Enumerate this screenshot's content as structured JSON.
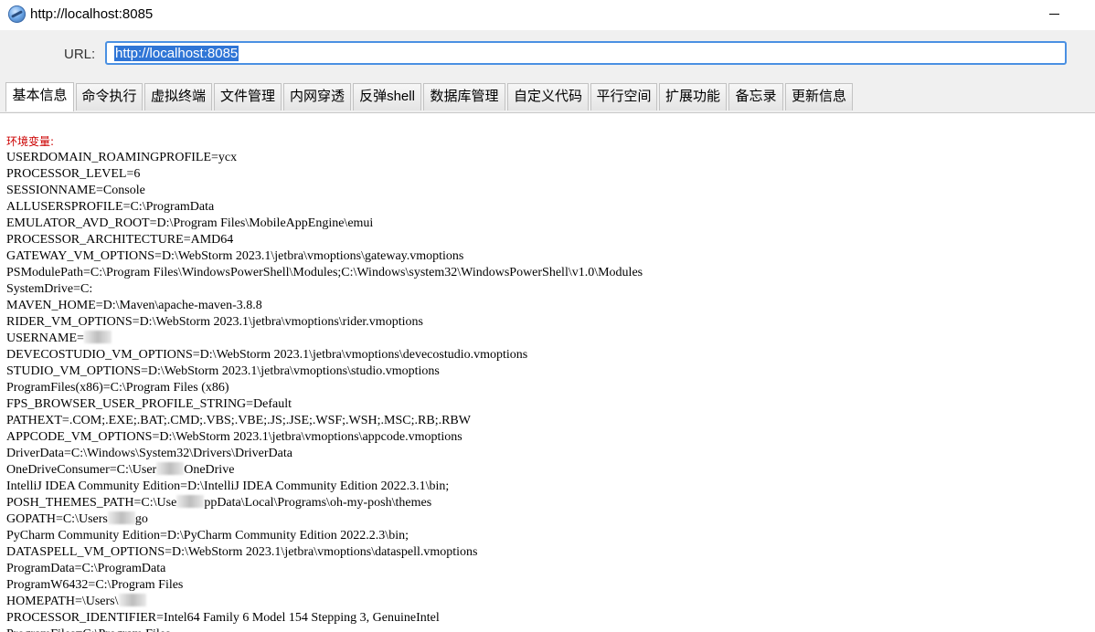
{
  "window": {
    "title": "http://localhost:8085",
    "icon": "globe-icon"
  },
  "url_bar": {
    "label": "URL:",
    "value": "http://localhost:8085",
    "selection_color": "#2f75d6",
    "focus_color": "#4a90e2"
  },
  "tabs": [
    {
      "label": "基本信息",
      "active": true
    },
    {
      "label": "命令执行",
      "active": false
    },
    {
      "label": "虚拟终端",
      "active": false
    },
    {
      "label": "文件管理",
      "active": false
    },
    {
      "label": "内网穿透",
      "active": false
    },
    {
      "label": "反弹shell",
      "active": false
    },
    {
      "label": "数据库管理",
      "active": false
    },
    {
      "label": "自定义代码",
      "active": false
    },
    {
      "label": "平行空间",
      "active": false
    },
    {
      "label": "扩展功能",
      "active": false
    },
    {
      "label": "备忘录",
      "active": false
    },
    {
      "label": "更新信息",
      "active": false
    }
  ],
  "content": {
    "heading": "环境变量:",
    "heading_color": "#cc0000",
    "lines": [
      {
        "pre": "USERDOMAIN_ROAMINGPROFILE=ycx"
      },
      {
        "pre": "PROCESSOR_LEVEL=6"
      },
      {
        "pre": "SESSIONNAME=Console"
      },
      {
        "pre": "ALLUSERSPROFILE=C:\\ProgramData"
      },
      {
        "pre": "EMULATOR_AVD_ROOT=D:\\Program Files\\MobileAppEngine\\emui"
      },
      {
        "pre": "PROCESSOR_ARCHITECTURE=AMD64"
      },
      {
        "pre": "GATEWAY_VM_OPTIONS=D:\\WebStorm 2023.1\\jetbra\\vmoptions\\gateway.vmoptions"
      },
      {
        "pre": "PSModulePath=C:\\Program Files\\WindowsPowerShell\\Modules;C:\\Windows\\system32\\WindowsPowerShell\\v1.0\\Modules"
      },
      {
        "pre": "SystemDrive=C:"
      },
      {
        "pre": "MAVEN_HOME=D:\\Maven\\apache-maven-3.8.8"
      },
      {
        "pre": "RIDER_VM_OPTIONS=D:\\WebStorm 2023.1\\jetbra\\vmoptions\\rider.vmoptions"
      },
      {
        "pre": "USERNAME=",
        "redacted": true
      },
      {
        "pre": "DEVECOSTUDIO_VM_OPTIONS=D:\\WebStorm 2023.1\\jetbra\\vmoptions\\devecostudio.vmoptions"
      },
      {
        "pre": "STUDIO_VM_OPTIONS=D:\\WebStorm 2023.1\\jetbra\\vmoptions\\studio.vmoptions"
      },
      {
        "pre": "ProgramFiles(x86)=C:\\Program Files (x86)"
      },
      {
        "pre": "FPS_BROWSER_USER_PROFILE_STRING=Default"
      },
      {
        "pre": "PATHEXT=.COM;.EXE;.BAT;.CMD;.VBS;.VBE;.JS;.JSE;.WSF;.WSH;.MSC;.RB;.RBW"
      },
      {
        "pre": "APPCODE_VM_OPTIONS=D:\\WebStorm 2023.1\\jetbra\\vmoptions\\appcode.vmoptions"
      },
      {
        "pre": "DriverData=C:\\Windows\\System32\\Drivers\\DriverData"
      },
      {
        "pre": "OneDriveConsumer=C:\\User",
        "redacted": true,
        "post": "OneDrive"
      },
      {
        "pre": "IntelliJ IDEA Community Edition=D:\\IntelliJ IDEA Community Edition 2022.3.1\\bin;"
      },
      {
        "pre": "POSH_THEMES_PATH=C:\\Use",
        "redacted": true,
        "post": "ppData\\Local\\Programs\\oh-my-posh\\themes"
      },
      {
        "pre": "GOPATH=C:\\Users",
        "redacted": true,
        "post": "go"
      },
      {
        "pre": "PyCharm Community Edition=D:\\PyCharm Community Edition 2022.2.3\\bin;"
      },
      {
        "pre": "DATASPELL_VM_OPTIONS=D:\\WebStorm 2023.1\\jetbra\\vmoptions\\dataspell.vmoptions"
      },
      {
        "pre": "ProgramData=C:\\ProgramData"
      },
      {
        "pre": "ProgramW6432=C:\\Program Files"
      },
      {
        "pre": "HOMEPATH=\\Users\\",
        "redacted": true
      },
      {
        "pre": "PROCESSOR_IDENTIFIER=Intel64 Family 6 Model 154 Stepping 3, GenuineIntel"
      },
      {
        "pre": "ProgramFiles=C:\\Program Files"
      }
    ]
  }
}
